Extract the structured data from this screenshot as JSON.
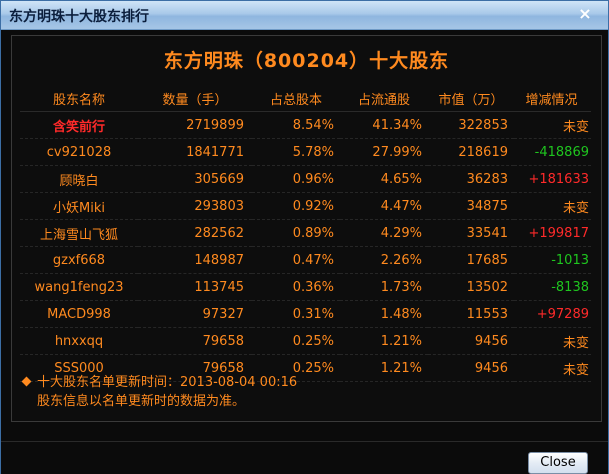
{
  "window": {
    "title": "东方明珠十大股东排行",
    "close_glyph": "×"
  },
  "heading": "东方明珠（800204）十大股东",
  "columns": [
    "股东名称",
    "数量（手）",
    "占总股本",
    "占流通股",
    "市值（万）",
    "增减情况"
  ],
  "rows": [
    {
      "name": "含笑前行",
      "qty": "2719899",
      "total_pct": "8.54%",
      "float_pct": "41.34%",
      "market_value": "322853",
      "change": "未变",
      "change_type": "same"
    },
    {
      "name": "cv921028",
      "qty": "1841771",
      "total_pct": "5.78%",
      "float_pct": "27.99%",
      "market_value": "218619",
      "change": "-418869",
      "change_type": "neg"
    },
    {
      "name": "顾晓白",
      "qty": "305669",
      "total_pct": "0.96%",
      "float_pct": "4.65%",
      "market_value": "36283",
      "change": "+181633",
      "change_type": "pos"
    },
    {
      "name": "小妖Miki",
      "qty": "293803",
      "total_pct": "0.92%",
      "float_pct": "4.47%",
      "market_value": "34875",
      "change": "未变",
      "change_type": "same"
    },
    {
      "name": "上海雪山飞狐",
      "qty": "282562",
      "total_pct": "0.89%",
      "float_pct": "4.29%",
      "market_value": "33541",
      "change": "+199817",
      "change_type": "pos"
    },
    {
      "name": "gzxf668",
      "qty": "148987",
      "total_pct": "0.47%",
      "float_pct": "2.26%",
      "market_value": "17685",
      "change": "-1013",
      "change_type": "neg"
    },
    {
      "name": "wang1feng23",
      "qty": "113745",
      "total_pct": "0.36%",
      "float_pct": "1.73%",
      "market_value": "13502",
      "change": "-8138",
      "change_type": "neg"
    },
    {
      "name": "MACD998",
      "qty": "97327",
      "total_pct": "0.31%",
      "float_pct": "1.48%",
      "market_value": "11553",
      "change": "+97289",
      "change_type": "pos"
    },
    {
      "name": "hnxxqq",
      "qty": "79658",
      "total_pct": "0.25%",
      "float_pct": "1.21%",
      "market_value": "9456",
      "change": "未变",
      "change_type": "same"
    },
    {
      "name": "SSS000",
      "qty": "79658",
      "total_pct": "0.25%",
      "float_pct": "1.21%",
      "market_value": "9456",
      "change": "未变",
      "change_type": "same"
    }
  ],
  "note": {
    "line1": "十大股东名单更新时间：2013-08-04 00:16",
    "line2": "股东信息以名单更新时的数据为准。"
  },
  "footer": {
    "close_label": "Close"
  },
  "colors": {
    "accent": "#ff8a1f",
    "up": "#ff2a2a",
    "down": "#1fc51f",
    "highlight_name": "#ff2a2a"
  }
}
